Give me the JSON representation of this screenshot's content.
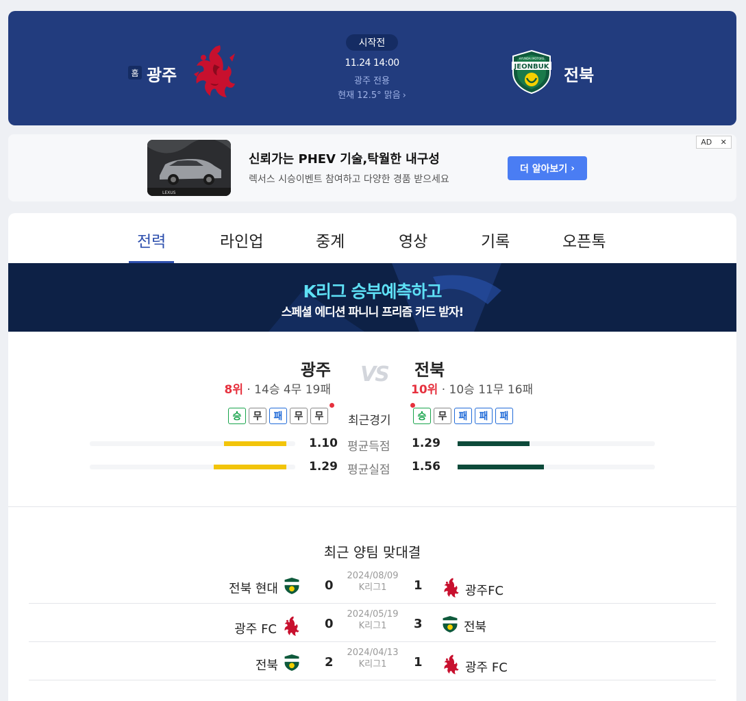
{
  "header": {
    "status": "시작전",
    "kickoff": "11.24 14:00",
    "broadcast": "광주 전용",
    "weather": "현재 12.5° 맑음",
    "home": {
      "badge": "홈",
      "name": "광주"
    },
    "away": {
      "name": "전북",
      "logo_text": "JEONBUK",
      "logo_subtext": "HYUNDAI MOTORS"
    }
  },
  "ad": {
    "title": "신뢰가는 PHEV 기술,탁월한 내구성",
    "description": "렉서스 시승이벤트 참여하고 다양한 경품 받으세요",
    "cta": "더 알아보기",
    "flag": "AD",
    "brand": "LEXUS"
  },
  "tabs": [
    "전력",
    "라인업",
    "중계",
    "영상",
    "기록",
    "오픈톡"
  ],
  "active_tab": "전력",
  "promo": {
    "line1": "K리그 승부예측하고",
    "line2": "스페셜 에디션 파니니 프리즘 카드 받자!"
  },
  "comparison": {
    "vs": "VS",
    "recent_label": "최근경기",
    "home": {
      "name": "광주",
      "rank": "8위",
      "record": "· 14승 4무 19패",
      "form": [
        "승",
        "무",
        "패",
        "무",
        "무"
      ],
      "avg_scored": "1.10",
      "avg_conceded": "1.29",
      "color": "#f2c40a"
    },
    "away": {
      "name": "전북",
      "rank": "10위",
      "record": "· 10승 11무 16패",
      "form": [
        "승",
        "무",
        "패",
        "패",
        "패"
      ],
      "avg_scored": "1.29",
      "avg_conceded": "1.56",
      "color": "#0d4a3a"
    },
    "stats": [
      {
        "label": "평균득점",
        "home": 1.1,
        "away": 1.29
      },
      {
        "label": "평균실점",
        "home": 1.29,
        "away": 1.56
      }
    ]
  },
  "h2h": {
    "title": "최근 양팀 맞대결",
    "matches": [
      {
        "left_team": "전북 현대",
        "left_logo": "jeonbuk",
        "left_score": "0",
        "date": "2024/08/09",
        "league": "K리그1",
        "right_score": "1",
        "right_team": "광주FC",
        "right_logo": "gwangju"
      },
      {
        "left_team": "광주 FC",
        "left_logo": "gwangju",
        "left_score": "0",
        "date": "2024/05/19",
        "league": "K리그1",
        "right_score": "3",
        "right_team": "전북",
        "right_logo": "jeonbuk"
      },
      {
        "left_team": "전북",
        "left_logo": "jeonbuk",
        "left_score": "2",
        "date": "2024/04/13",
        "league": "K리그1",
        "right_score": "1",
        "right_team": "광주 FC",
        "right_logo": "gwangju"
      }
    ]
  }
}
